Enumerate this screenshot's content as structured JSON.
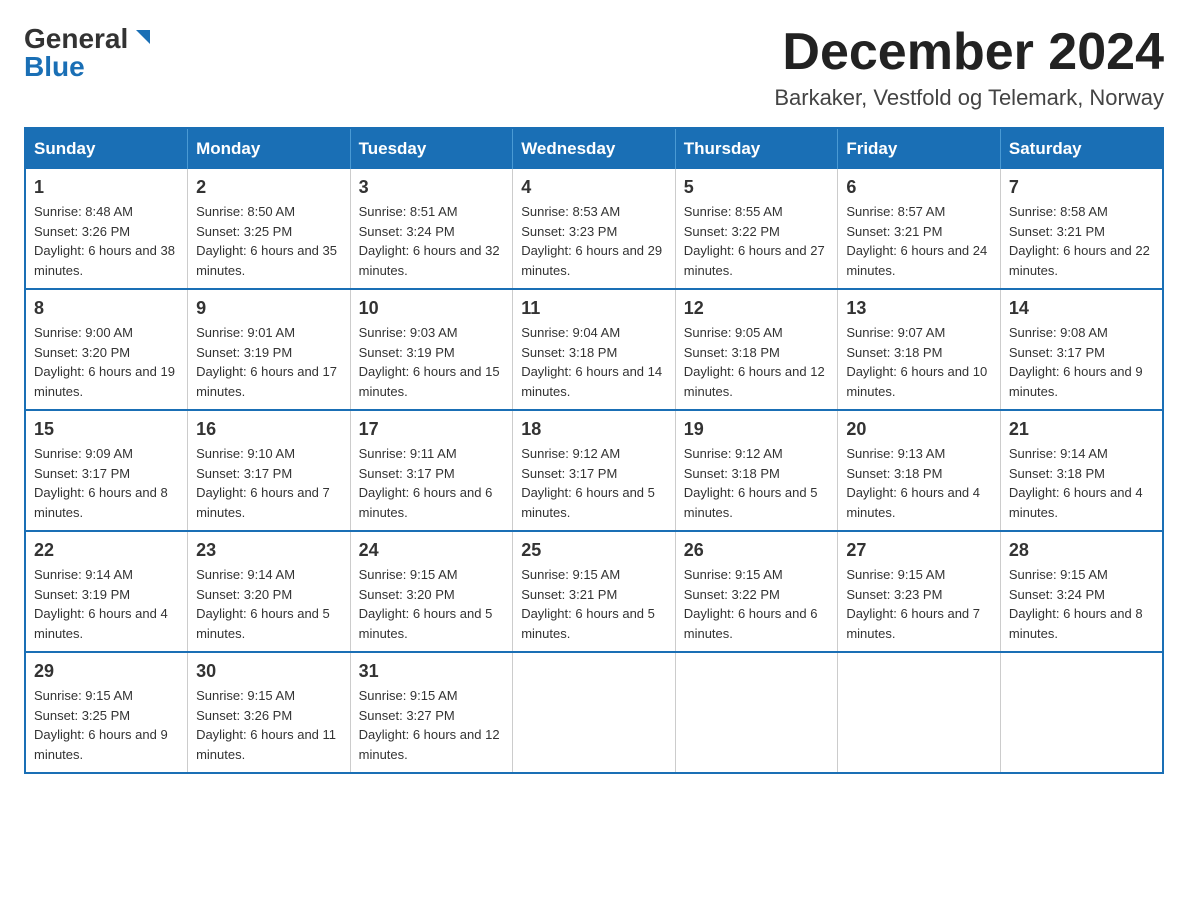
{
  "header": {
    "logo_general": "General",
    "logo_blue": "Blue",
    "month_title": "December 2024",
    "location": "Barkaker, Vestfold og Telemark, Norway"
  },
  "weekdays": [
    "Sunday",
    "Monday",
    "Tuesday",
    "Wednesday",
    "Thursday",
    "Friday",
    "Saturday"
  ],
  "weeks": [
    [
      {
        "day": "1",
        "sunrise": "8:48 AM",
        "sunset": "3:26 PM",
        "daylight": "6 hours and 38 minutes."
      },
      {
        "day": "2",
        "sunrise": "8:50 AM",
        "sunset": "3:25 PM",
        "daylight": "6 hours and 35 minutes."
      },
      {
        "day": "3",
        "sunrise": "8:51 AM",
        "sunset": "3:24 PM",
        "daylight": "6 hours and 32 minutes."
      },
      {
        "day": "4",
        "sunrise": "8:53 AM",
        "sunset": "3:23 PM",
        "daylight": "6 hours and 29 minutes."
      },
      {
        "day": "5",
        "sunrise": "8:55 AM",
        "sunset": "3:22 PM",
        "daylight": "6 hours and 27 minutes."
      },
      {
        "day": "6",
        "sunrise": "8:57 AM",
        "sunset": "3:21 PM",
        "daylight": "6 hours and 24 minutes."
      },
      {
        "day": "7",
        "sunrise": "8:58 AM",
        "sunset": "3:21 PM",
        "daylight": "6 hours and 22 minutes."
      }
    ],
    [
      {
        "day": "8",
        "sunrise": "9:00 AM",
        "sunset": "3:20 PM",
        "daylight": "6 hours and 19 minutes."
      },
      {
        "day": "9",
        "sunrise": "9:01 AM",
        "sunset": "3:19 PM",
        "daylight": "6 hours and 17 minutes."
      },
      {
        "day": "10",
        "sunrise": "9:03 AM",
        "sunset": "3:19 PM",
        "daylight": "6 hours and 15 minutes."
      },
      {
        "day": "11",
        "sunrise": "9:04 AM",
        "sunset": "3:18 PM",
        "daylight": "6 hours and 14 minutes."
      },
      {
        "day": "12",
        "sunrise": "9:05 AM",
        "sunset": "3:18 PM",
        "daylight": "6 hours and 12 minutes."
      },
      {
        "day": "13",
        "sunrise": "9:07 AM",
        "sunset": "3:18 PM",
        "daylight": "6 hours and 10 minutes."
      },
      {
        "day": "14",
        "sunrise": "9:08 AM",
        "sunset": "3:17 PM",
        "daylight": "6 hours and 9 minutes."
      }
    ],
    [
      {
        "day": "15",
        "sunrise": "9:09 AM",
        "sunset": "3:17 PM",
        "daylight": "6 hours and 8 minutes."
      },
      {
        "day": "16",
        "sunrise": "9:10 AM",
        "sunset": "3:17 PM",
        "daylight": "6 hours and 7 minutes."
      },
      {
        "day": "17",
        "sunrise": "9:11 AM",
        "sunset": "3:17 PM",
        "daylight": "6 hours and 6 minutes."
      },
      {
        "day": "18",
        "sunrise": "9:12 AM",
        "sunset": "3:17 PM",
        "daylight": "6 hours and 5 minutes."
      },
      {
        "day": "19",
        "sunrise": "9:12 AM",
        "sunset": "3:18 PM",
        "daylight": "6 hours and 5 minutes."
      },
      {
        "day": "20",
        "sunrise": "9:13 AM",
        "sunset": "3:18 PM",
        "daylight": "6 hours and 4 minutes."
      },
      {
        "day": "21",
        "sunrise": "9:14 AM",
        "sunset": "3:18 PM",
        "daylight": "6 hours and 4 minutes."
      }
    ],
    [
      {
        "day": "22",
        "sunrise": "9:14 AM",
        "sunset": "3:19 PM",
        "daylight": "6 hours and 4 minutes."
      },
      {
        "day": "23",
        "sunrise": "9:14 AM",
        "sunset": "3:20 PM",
        "daylight": "6 hours and 5 minutes."
      },
      {
        "day": "24",
        "sunrise": "9:15 AM",
        "sunset": "3:20 PM",
        "daylight": "6 hours and 5 minutes."
      },
      {
        "day": "25",
        "sunrise": "9:15 AM",
        "sunset": "3:21 PM",
        "daylight": "6 hours and 5 minutes."
      },
      {
        "day": "26",
        "sunrise": "9:15 AM",
        "sunset": "3:22 PM",
        "daylight": "6 hours and 6 minutes."
      },
      {
        "day": "27",
        "sunrise": "9:15 AM",
        "sunset": "3:23 PM",
        "daylight": "6 hours and 7 minutes."
      },
      {
        "day": "28",
        "sunrise": "9:15 AM",
        "sunset": "3:24 PM",
        "daylight": "6 hours and 8 minutes."
      }
    ],
    [
      {
        "day": "29",
        "sunrise": "9:15 AM",
        "sunset": "3:25 PM",
        "daylight": "6 hours and 9 minutes."
      },
      {
        "day": "30",
        "sunrise": "9:15 AM",
        "sunset": "3:26 PM",
        "daylight": "6 hours and 11 minutes."
      },
      {
        "day": "31",
        "sunrise": "9:15 AM",
        "sunset": "3:27 PM",
        "daylight": "6 hours and 12 minutes."
      },
      null,
      null,
      null,
      null
    ]
  ]
}
